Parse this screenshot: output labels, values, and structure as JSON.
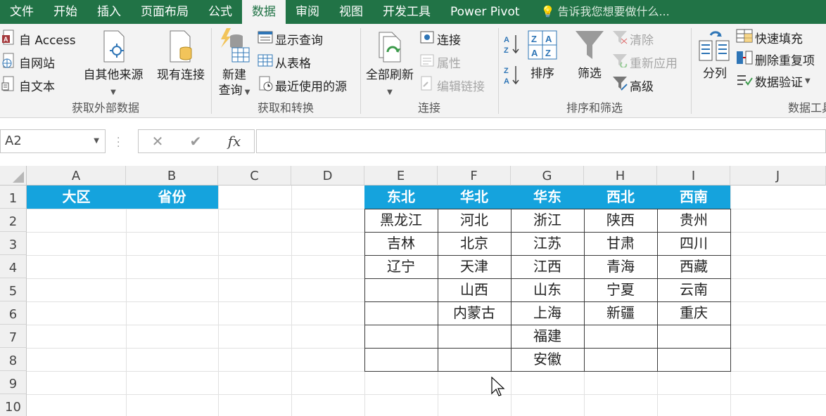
{
  "tabs": [
    "文件",
    "开始",
    "插入",
    "页面布局",
    "公式",
    "数据",
    "审阅",
    "视图",
    "开发工具",
    "Power Pivot"
  ],
  "active_tab": "数据",
  "tell_me": "告诉我您想要做什么...",
  "ribbon": {
    "get_external": {
      "title": "获取外部数据",
      "from_access": "自 Access",
      "from_web": "自网站",
      "from_text": "自文本",
      "from_other": "自其他来源",
      "existing": "现有连接"
    },
    "get_transform": {
      "title": "获取和转换",
      "new_query_1": "新建",
      "new_query_2": "查询",
      "show_query": "显示查询",
      "from_table": "从表格",
      "recent_source": "最近使用的源"
    },
    "connections": {
      "title": "连接",
      "refresh_all": "全部刷新",
      "connections": "连接",
      "properties": "属性",
      "edit_links": "编辑链接"
    },
    "sort_filter": {
      "title": "排序和筛选",
      "sort": "排序",
      "filter": "筛选",
      "clear": "清除",
      "reapply": "重新应用",
      "advanced": "高级"
    },
    "data_tools": {
      "title": "数据工具",
      "text_to_columns": "分列",
      "flash_fill": "快速填充",
      "remove_duplicates": "删除重复项",
      "data_validation": "数据验证"
    }
  },
  "name_box": "A2",
  "formula_icons": {
    "cancel": "✕",
    "enter": "✔",
    "fx": "fx"
  },
  "columns": [
    "A",
    "B",
    "C",
    "D",
    "E",
    "F",
    "G",
    "H",
    "I",
    "J"
  ],
  "rows": [
    "1",
    "2",
    "3",
    "4",
    "5",
    "6",
    "7",
    "8",
    "9",
    "10"
  ],
  "left_table": {
    "header_a": "大区",
    "header_b": "省份"
  },
  "region_table": {
    "headers": [
      "东北",
      "华北",
      "华东",
      "西北",
      "西南"
    ],
    "rows": [
      [
        "黑龙江",
        "河北",
        "浙江",
        "陕西",
        "贵州"
      ],
      [
        "吉林",
        "北京",
        "江苏",
        "甘肃",
        "四川"
      ],
      [
        "辽宁",
        "天津",
        "江西",
        "青海",
        "西藏"
      ],
      [
        "",
        "山西",
        "山东",
        "宁夏",
        "云南"
      ],
      [
        "",
        "内蒙古",
        "上海",
        "新疆",
        "重庆"
      ],
      [
        "",
        "",
        "福建",
        "",
        ""
      ],
      [
        "",
        "",
        "安徽",
        "",
        ""
      ]
    ]
  },
  "colors": {
    "excel_green": "#217346",
    "header_blue": "#15a3dd"
  }
}
